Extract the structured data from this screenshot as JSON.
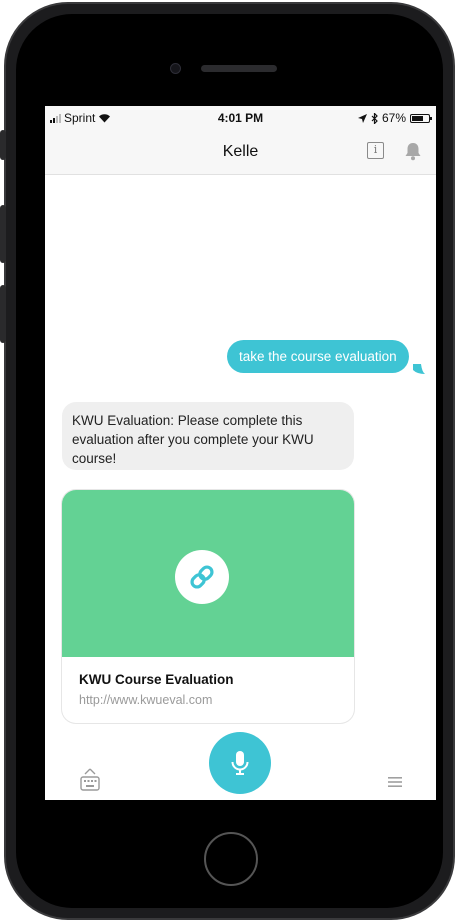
{
  "status_bar": {
    "carrier": "Sprint",
    "time": "4:01 PM",
    "battery_percent": "67%",
    "battery_level": 0.67
  },
  "header": {
    "title": "Kelle",
    "info_icon": "info-icon",
    "notification_icon": "bell-icon"
  },
  "messages": {
    "user_message": "take the course evaluation",
    "bot_message": "KWU Evaluation: Please complete this evaluation after you complete your KWU course!"
  },
  "link_card": {
    "title": "KWU Course Evaluation",
    "url": "http://www.kwueval.com",
    "icon": "link-icon"
  },
  "toolbar": {
    "keyboard_icon": "keyboard-icon",
    "mic_icon": "microphone-icon",
    "menu_icon": "menu-icon"
  },
  "colors": {
    "accent": "#3ec4d4",
    "card_hero": "#63d294",
    "bubble_bot": "#efefef"
  }
}
